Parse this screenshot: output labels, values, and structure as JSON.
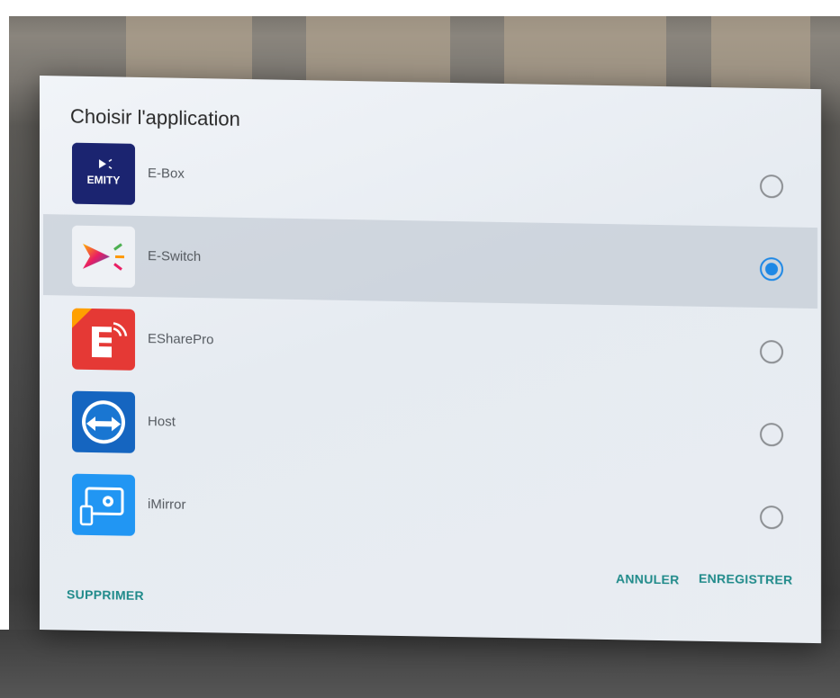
{
  "dialog": {
    "title": "Choisir l'application",
    "apps": [
      {
        "label": "E-Box",
        "icon": "emity-icon",
        "selected": false
      },
      {
        "label": "E-Switch",
        "icon": "eswitch-icon",
        "selected": true
      },
      {
        "label": "ESharePro",
        "icon": "esharepro-icon",
        "selected": false
      },
      {
        "label": "Host",
        "icon": "host-icon",
        "selected": false
      },
      {
        "label": "iMirror",
        "icon": "imirror-icon",
        "selected": false
      }
    ],
    "icon_texts": {
      "emity": "EMITY"
    },
    "buttons": {
      "delete": "SUPPRIMER",
      "cancel": "ANNULER",
      "save": "ENREGISTRER"
    }
  },
  "colors": {
    "accent": "#1e88e5",
    "button_text": "#1f8a8a"
  }
}
